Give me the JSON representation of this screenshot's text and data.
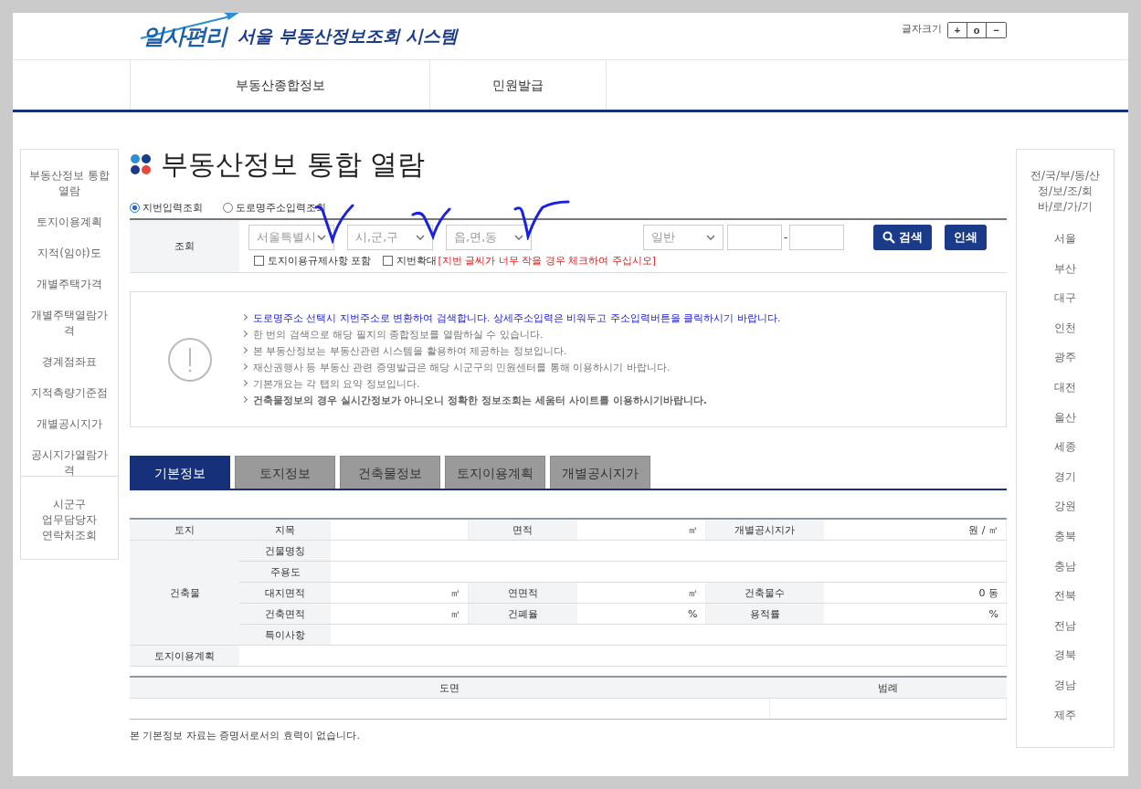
{
  "header": {
    "logo": "일사편리",
    "system_title": "서울 부동산정보조회 시스템",
    "font_size_label": "글자크기",
    "font_buttons": [
      "+",
      "o",
      "−"
    ]
  },
  "nav": [
    "부동산종합정보",
    "민원발급"
  ],
  "left_menu": {
    "items": [
      "부동산정보 통합 열람",
      "토지이용계획",
      "지적(임야)도",
      "개별주택가격",
      "개별주택열람가격",
      "경계점좌표",
      "지적측량기준점",
      "개별공시지가",
      "공시지가열람가격"
    ],
    "contact": "시군구\n업무담당자\n연락처조회"
  },
  "page_title": "부동산정보 통합 열람",
  "search_modes": [
    {
      "label": "지번입력조회",
      "selected": true
    },
    {
      "label": "도로명주소입력조회",
      "selected": false
    }
  ],
  "search": {
    "label": "조회",
    "selects": [
      "서울특별시",
      "시,군,구",
      "읍,면,동"
    ],
    "type_select": "일반",
    "separator": "-",
    "checkboxes": [
      {
        "label": "토지이용규제사항 포함",
        "checked": false
      },
      {
        "label": "지번확대",
        "checked": false
      }
    ],
    "note": "[지번 글씨가 너무 작을 경우 체크하여 주십시오]",
    "search_button": "검색",
    "print_button": "인쇄"
  },
  "notices": [
    {
      "kind": "highlight",
      "text": "도로명주소 선택시 지번주소로 변환하여 검색합니다. 상세주소입력은 비워두고 주소입력버튼을 클릭하시기 바랍니다."
    },
    {
      "kind": "normal",
      "text": "한 번의 검색으로 해당 필지의 종합정보를 열람하실 수 있습니다."
    },
    {
      "kind": "normal",
      "text": "본 부동산정보는 부동산관련 시스템을 활용하여 제공하는 정보입니다."
    },
    {
      "kind": "normal",
      "text": "재산권행사 등 부동산 관련 증명발급은 해당 시군구의 민원센터를 통해 이용하시기 바랍니다."
    },
    {
      "kind": "normal",
      "text": "기본개요는 각 탭의 요약 정보입니다."
    },
    {
      "kind": "bold",
      "text": "건축물정보의 경우 실시간정보가 아니오니 정확한 정보조회는 세움터 사이트를 이용하시기바랍니다."
    }
  ],
  "tabs": [
    {
      "label": "기본정보",
      "selected": true
    },
    {
      "label": "토지정보",
      "selected": false
    },
    {
      "label": "건축물정보",
      "selected": false
    },
    {
      "label": "토지이용계획",
      "selected": false
    },
    {
      "label": "개별공시지가",
      "selected": false
    }
  ],
  "info_table": {
    "groups": [
      {
        "label": "토지",
        "rows": [
          [
            {
              "label": "지목"
            },
            {
              "label": "면적",
              "value": "㎡"
            },
            {
              "label": "개별공시지가",
              "value": "원 / ㎡"
            }
          ]
        ]
      },
      {
        "label": "건축물",
        "rows": [
          [
            {
              "label": "건물명칭"
            }
          ],
          [
            {
              "label": "주용도"
            }
          ],
          [
            {
              "label": "대지면적",
              "value": "㎡"
            },
            {
              "label": "연면적",
              "value": "㎡"
            },
            {
              "label": "건축물수",
              "value": "0 동"
            }
          ],
          [
            {
              "label": "건축면적",
              "value": "㎡"
            },
            {
              "label": "건폐율",
              "value": "%"
            },
            {
              "label": "용적률",
              "value": "%"
            }
          ],
          [
            {
              "label": "특이사항"
            }
          ]
        ]
      }
    ],
    "plan_label": "토지이용계획"
  },
  "map_table": {
    "columns": [
      "도면",
      "범례"
    ]
  },
  "footnote": "본 기본정보 자료는 증명서로서의 효력이 없습니다.",
  "right_menu": {
    "title": "전/국/부/동/산\n정/보/조/회\n바/로/가/기",
    "items": [
      "서울",
      "부산",
      "대구",
      "인천",
      "광주",
      "대전",
      "울산",
      "세종",
      "경기",
      "강원",
      "충북",
      "충남",
      "전북",
      "전남",
      "경북",
      "경남",
      "제주"
    ]
  }
}
